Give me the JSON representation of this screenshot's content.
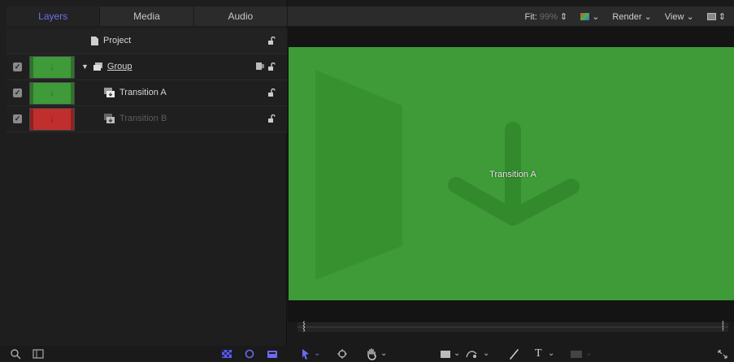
{
  "tabs": [
    {
      "label": "Layers",
      "active": true
    },
    {
      "label": "Media",
      "active": false
    },
    {
      "label": "Audio",
      "active": false
    }
  ],
  "project": {
    "label": "Project"
  },
  "layers": [
    {
      "label": "Group",
      "checked": true,
      "thumb": "green",
      "kind": "group"
    },
    {
      "label": "Transition A",
      "checked": true,
      "thumb": "green",
      "kind": "transition",
      "dim": false
    },
    {
      "label": "Transition B",
      "checked": true,
      "thumb": "red",
      "kind": "transition",
      "dim": true
    }
  ],
  "viewer": {
    "fit_label": "Fit:",
    "fit_value": "99%",
    "render_label": "Render",
    "view_label": "View",
    "canvas_text": "Transition A",
    "canvas_color": "#3e9b38"
  },
  "icons": {
    "search": "search-icon",
    "panel": "panel-toggle-icon",
    "arrow": "select-arrow-icon",
    "hand": "hand-icon",
    "text": "text-tool-icon"
  },
  "toolbar": {
    "text_tool": "T"
  }
}
